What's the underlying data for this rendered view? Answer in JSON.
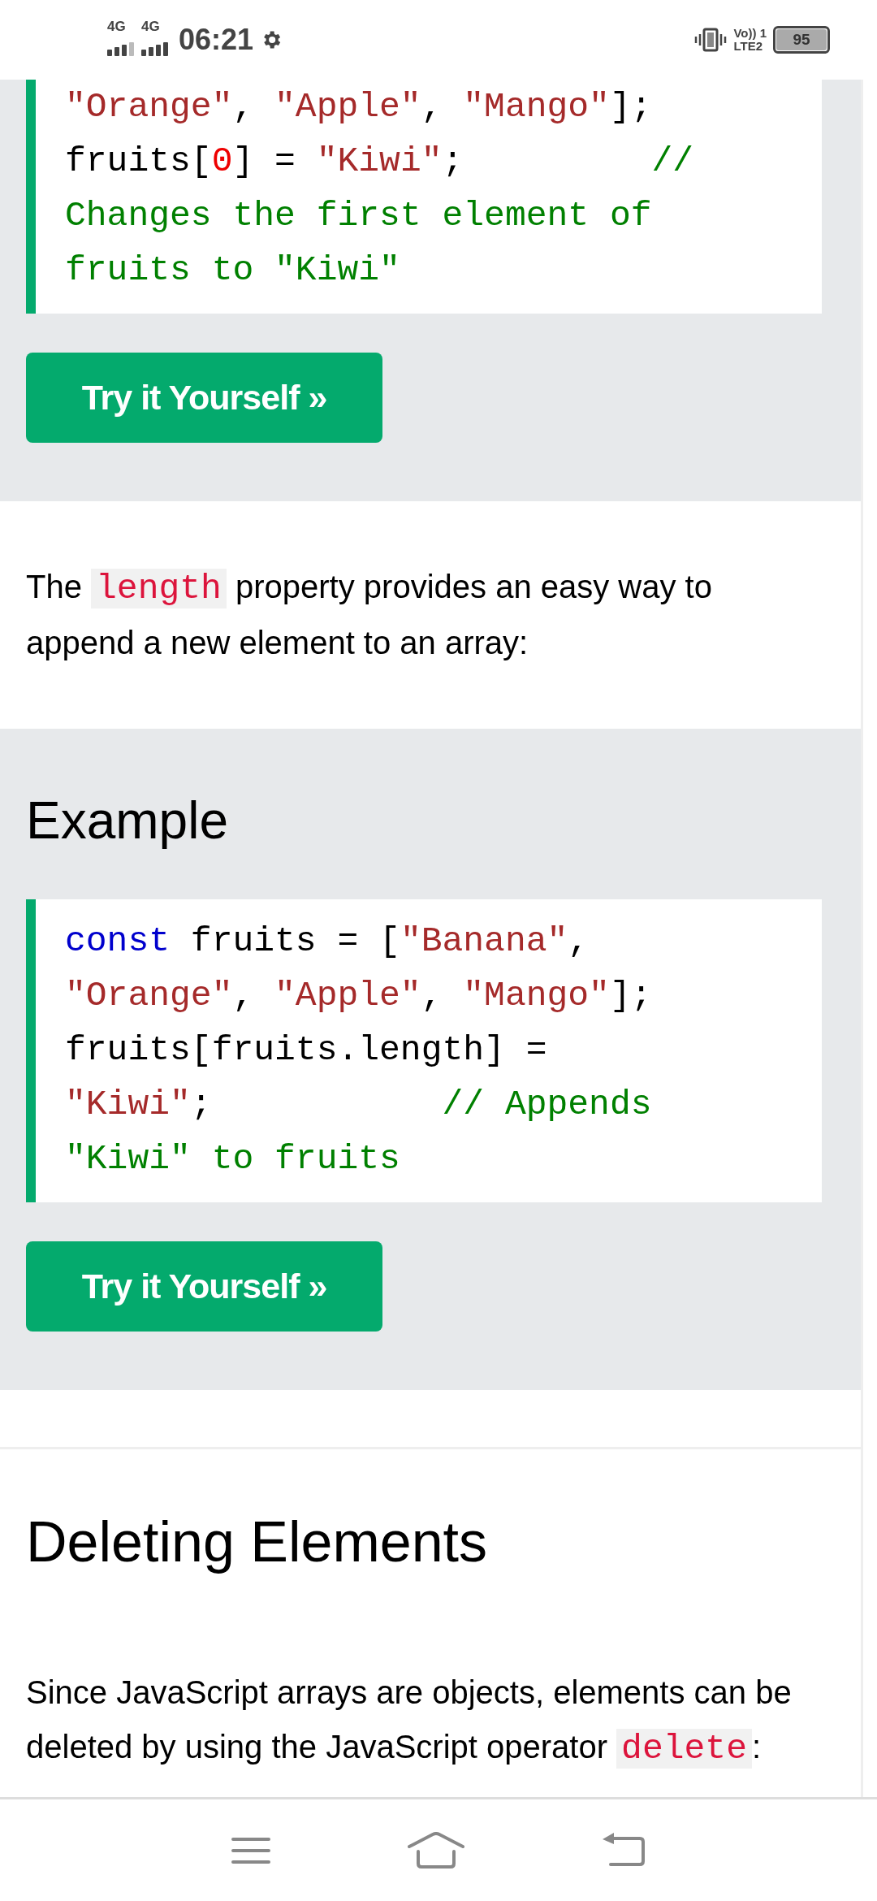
{
  "status_bar": {
    "network_labels": [
      "4G",
      "4G"
    ],
    "time": "06:21",
    "volte_lines": [
      "Vo)) 1",
      "LTE2"
    ],
    "battery": "95"
  },
  "sections": [
    {
      "kind": "example",
      "code": [
        [
          {
            "kind": "string",
            "text": "\"Orange\""
          },
          {
            "kind": "plain",
            "text": ", "
          },
          {
            "kind": "string",
            "text": "\"Apple\""
          },
          {
            "kind": "plain",
            "text": ", "
          },
          {
            "kind": "string",
            "text": "\"Mango\""
          },
          {
            "kind": "plain",
            "text": "];"
          }
        ],
        [
          {
            "kind": "plain",
            "text": "fruits["
          },
          {
            "kind": "number",
            "text": "0"
          },
          {
            "kind": "plain",
            "text": "] = "
          },
          {
            "kind": "string",
            "text": "\"Kiwi\""
          },
          {
            "kind": "plain",
            "text": ";         "
          },
          {
            "kind": "comment",
            "text": "//"
          }
        ],
        [
          {
            "kind": "comment",
            "text": "Changes the first element of"
          }
        ],
        [
          {
            "kind": "comment",
            "text": "fruits to \"Kiwi\""
          }
        ]
      ],
      "button": "Try it Yourself »"
    },
    {
      "kind": "paragraph",
      "parts": [
        {
          "kind": "text",
          "text": "The "
        },
        {
          "kind": "code",
          "text": "length"
        },
        {
          "kind": "text",
          "text": " property provides an easy way to append a new element to an array:"
        }
      ]
    },
    {
      "kind": "example",
      "heading": "Example",
      "code": [
        [
          {
            "kind": "keyword",
            "text": "const"
          },
          {
            "kind": "plain",
            "text": " fruits = ["
          },
          {
            "kind": "string",
            "text": "\"Banana\""
          },
          {
            "kind": "plain",
            "text": ","
          }
        ],
        [
          {
            "kind": "string",
            "text": "\"Orange\""
          },
          {
            "kind": "plain",
            "text": ", "
          },
          {
            "kind": "string",
            "text": "\"Apple\""
          },
          {
            "kind": "plain",
            "text": ", "
          },
          {
            "kind": "string",
            "text": "\"Mango\""
          },
          {
            "kind": "plain",
            "text": "];"
          }
        ],
        [
          {
            "kind": "plain",
            "text": "fruits[fruits.length] ="
          }
        ],
        [
          {
            "kind": "string",
            "text": "\"Kiwi\""
          },
          {
            "kind": "plain",
            "text": ";           "
          },
          {
            "kind": "comment",
            "text": "// Appends"
          }
        ],
        [
          {
            "kind": "comment",
            "text": "\"Kiwi\" to fruits"
          }
        ]
      ],
      "button": "Try it Yourself »"
    },
    {
      "kind": "heading",
      "text": "Deleting Elements"
    },
    {
      "kind": "paragraph",
      "parts": [
        {
          "kind": "text",
          "text": "Since JavaScript arrays are objects, elements can be deleted by using the JavaScript operator "
        },
        {
          "kind": "code",
          "text": "delete"
        },
        {
          "kind": "text",
          "text": ":"
        }
      ]
    }
  ]
}
